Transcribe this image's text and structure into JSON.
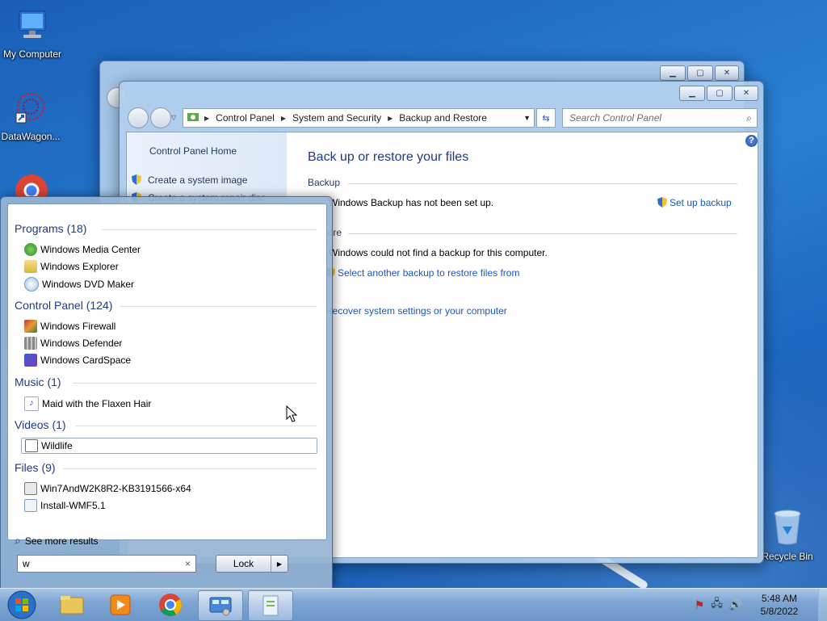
{
  "desktop": {
    "icons": [
      {
        "label": "My Computer",
        "icon": "computer-icon"
      },
      {
        "label": "DataWagon...",
        "icon": "datawagon-shortcut-icon"
      },
      {
        "label": "Recycle Bin",
        "icon": "recycle-bin-icon"
      }
    ]
  },
  "control_panel": {
    "breadcrumb": [
      "Control Panel",
      "System and Security",
      "Backup and Restore"
    ],
    "search_placeholder": "Search Control Panel",
    "left_nav": {
      "home": "Control Panel Home",
      "items": [
        "Create a system image",
        "Create a system repair disc"
      ]
    },
    "heading": "Back up or restore your files",
    "backup": {
      "section_label": "Backup",
      "status": "Windows Backup has not been set up.",
      "setup_link": "Set up backup"
    },
    "restore": {
      "section_label": "Restore",
      "status": "Windows could not find a backup for this computer.",
      "select_link": "Select another backup to restore files from",
      "recover_link": "Recover system settings or your computer"
    }
  },
  "start_menu": {
    "groups": [
      {
        "title": "Programs (18)",
        "items": [
          "Windows Media Center",
          "Windows Explorer",
          "Windows DVD Maker"
        ]
      },
      {
        "title": "Control Panel (124)",
        "items": [
          "Windows Firewall",
          "Windows Defender",
          "Windows CardSpace"
        ]
      },
      {
        "title": "Music (1)",
        "items": [
          "Maid with the Flaxen Hair"
        ]
      },
      {
        "title": "Videos (1)",
        "items": [
          "Wildlife"
        ]
      },
      {
        "title": "Files (9)",
        "items": [
          "Win7AndW2K8R2-KB3191566-x64",
          "Install-WMF5.1"
        ]
      }
    ],
    "see_more": "See more results",
    "search_value": "w",
    "clear_glyph": "×",
    "power_button": "Lock"
  },
  "taskbar": {
    "start": "start-orb-icon",
    "pinned": [
      "explorer-icon",
      "media-player-icon",
      "chrome-icon",
      "control-panel-icon",
      "document-icon"
    ],
    "clock_time": "5:48 AM",
    "clock_date": "5/8/2022"
  },
  "colors": {
    "link": "#1a56c6",
    "heading": "#1e3b8a",
    "taskbar": "#7fa6d3"
  }
}
